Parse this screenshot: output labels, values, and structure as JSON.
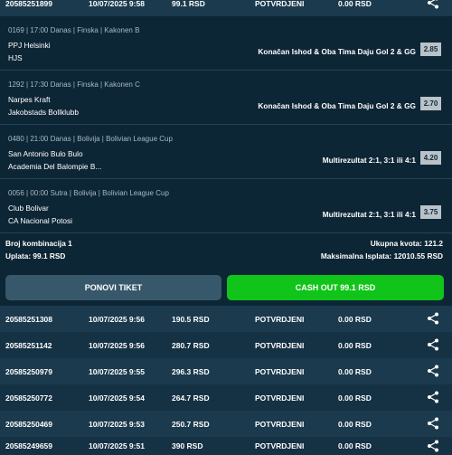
{
  "top_row": {
    "id": "20585251899",
    "date": "10/07/2025 9:58",
    "amount": "99.1 RSD",
    "status": "POTVRDJENI",
    "win": "0.00 RSD"
  },
  "ticket": {
    "matches": [
      {
        "meta": "0169 | 17:00 Danas | Finska | Kakonen B",
        "team1": "PPJ Helsinki",
        "team2": "HJS",
        "tip": "Konačan Ishod & Oba Tima Daju Gol 2 & GG",
        "odd": "2.85"
      },
      {
        "meta": "1292 | 17:30 Danas | Finska | Kakonen C",
        "team1": "Narpes Kraft",
        "team2": "Jakobstads Bollklubb",
        "tip": "Konačan Ishod & Oba Tima Daju Gol 2 & GG",
        "odd": "2.70"
      },
      {
        "meta": "0480 | 21:00 Danas | Bolivija | Bolivian League Cup",
        "team1": "San Antonio Bulo Bulo",
        "team2": "Academia Del Balompie B...",
        "tip": "Multirezultat 2:1, 3:1 ili 4:1",
        "odd": "4.20"
      },
      {
        "meta": "0056 | 00:00 Sutra | Bolivija | Bolivian League Cup",
        "team1": "Club Bolivar",
        "team2": "CA Nacional Potosi",
        "tip": "Multirezultat 2:1, 3:1 ili 4:1",
        "odd": "3.75"
      }
    ],
    "summary": {
      "combinations": "Broj kombinacija 1",
      "stake": "Uplata: 99.1 RSD",
      "total_odds": "Ukupna kvota: 121.2",
      "max_payout": "Maksimalna Isplata: 12010.55 RSD"
    },
    "buttons": {
      "repeat": "PONOVI TIKET",
      "cashout": "CASH OUT 99.1 RSD"
    }
  },
  "rows": [
    {
      "id": "20585251308",
      "date": "10/07/2025 9:56",
      "amount": "190.5 RSD",
      "status": "POTVRDJENI",
      "win": "0.00 RSD"
    },
    {
      "id": "20585251142",
      "date": "10/07/2025 9:56",
      "amount": "280.7 RSD",
      "status": "POTVRDJENI",
      "win": "0.00 RSD"
    },
    {
      "id": "20585250979",
      "date": "10/07/2025 9:55",
      "amount": "296.3 RSD",
      "status": "POTVRDJENI",
      "win": "0.00 RSD"
    },
    {
      "id": "20585250772",
      "date": "10/07/2025 9:54",
      "amount": "264.7 RSD",
      "status": "POTVRDJENI",
      "win": "0.00 RSD"
    },
    {
      "id": "20585250469",
      "date": "10/07/2025 9:53",
      "amount": "250.7 RSD",
      "status": "POTVRDJENI",
      "win": "0.00 RSD"
    },
    {
      "id": "20585249659",
      "date": "10/07/2025 9:51",
      "amount": "390 RSD",
      "status": "POTVRDJENI",
      "win": "0.00 RSD"
    }
  ],
  "colors": {
    "accent_green": "#11c41a",
    "bg": "#0f2a3a",
    "row_odd": "#1b3a4d",
    "row_even": "#153244"
  },
  "icons": {
    "share": "share-icon"
  }
}
